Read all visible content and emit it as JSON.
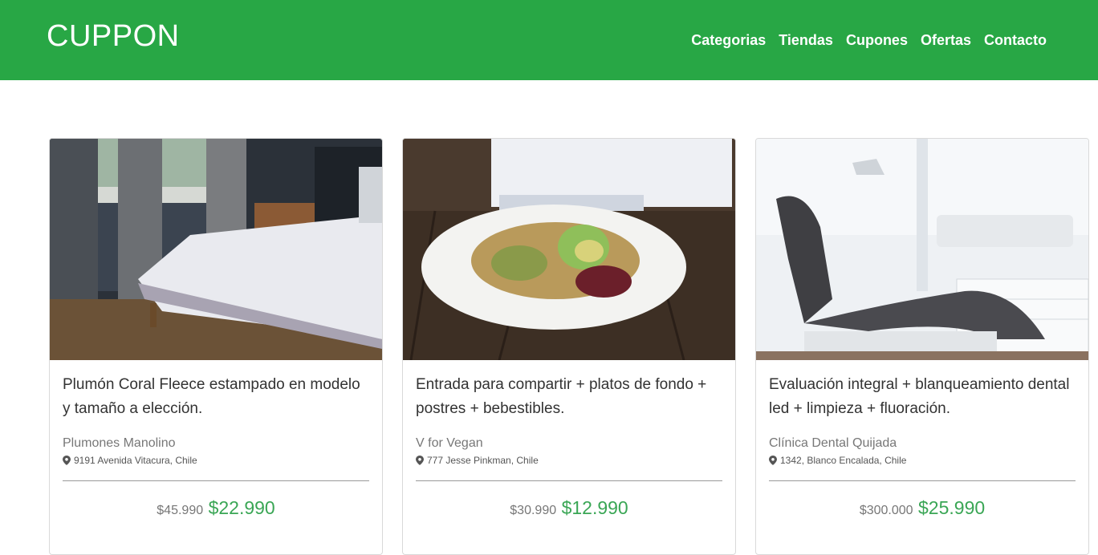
{
  "brand": "CUPPON",
  "nav": [
    "Categorias",
    "Tiendas",
    "Cupones",
    "Ofertas",
    "Contacto"
  ],
  "colors": {
    "header": "#28a745",
    "price": "#3aa655"
  },
  "cards": [
    {
      "image": "bedroom-photo",
      "title": "Plumón Coral Fleece estampado en modelo y tamaño a elección.",
      "vendor": "Plumones Manolino",
      "address": "9191 Avenida Vitacura, Chile",
      "old_price": "$45.990",
      "new_price": "$22.990"
    },
    {
      "image": "salad-plate-photo",
      "title": "Entrada para compartir + platos de fondo + postres + bebestibles.",
      "vendor": "V for Vegan",
      "address": "777 Jesse Pinkman, Chile",
      "old_price": "$30.990",
      "new_price": "$12.990"
    },
    {
      "image": "dental-chair-photo",
      "title": "Evaluación integral + blanqueamiento dental led + limpieza + fluoración.",
      "vendor": "Clínica Dental Quijada",
      "address": "1342, Blanco Encalada, Chile",
      "old_price": "$300.000",
      "new_price": "$25.990"
    }
  ]
}
